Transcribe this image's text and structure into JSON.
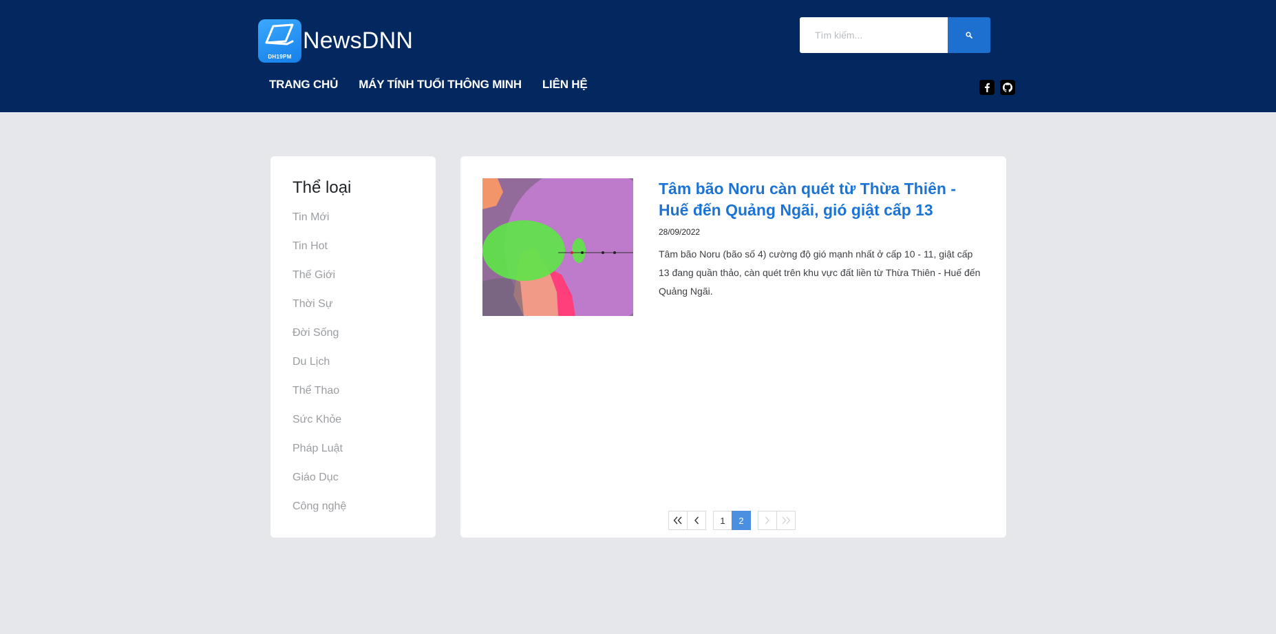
{
  "site": {
    "name": "NewsDNN",
    "badge_text": "DH19PM"
  },
  "search": {
    "placeholder": "Tìm kiếm...",
    "button_icon": "search-icon"
  },
  "nav": {
    "items": [
      {
        "label": "TRANG CHỦ"
      },
      {
        "label": "MÁY TÍNH TUỔI THÔNG MINH"
      },
      {
        "label": "LIÊN HỆ"
      }
    ]
  },
  "social": {
    "items": [
      {
        "icon": "facebook-icon"
      },
      {
        "icon": "github-icon"
      }
    ]
  },
  "sidebar": {
    "title": "Thể loại",
    "categories": [
      {
        "label": "Tin Mới"
      },
      {
        "label": "Tin Hot"
      },
      {
        "label": "Thế Giới"
      },
      {
        "label": "Thời Sự"
      },
      {
        "label": "Đời Sống"
      },
      {
        "label": "Du Lịch"
      },
      {
        "label": "Thể Thao"
      },
      {
        "label": "Sức Khỏe"
      },
      {
        "label": "Pháp Luật"
      },
      {
        "label": "Giáo Dục"
      },
      {
        "label": "Công nghệ"
      }
    ]
  },
  "article": {
    "title": "Tâm bão Noru càn quét từ Thừa Thiên - Huế đến Quảng Ngãi, gió giật cấp 13",
    "date": "28/09/2022",
    "summary": "Tâm bão Noru (bão số 4) cường độ gió mạnh nhất ở cấp 10 - 11, giật cấp 13 đang quần thảo, càn quét trên khu vực đất liền từ Thừa Thiên - Huế đến Quảng Ngãi."
  },
  "pagination": {
    "pages": [
      "1",
      "2"
    ],
    "current": "2"
  },
  "colors": {
    "header_bg": "#03285f",
    "accent": "#1b74d5",
    "page_bg": "#e5e7ea"
  }
}
